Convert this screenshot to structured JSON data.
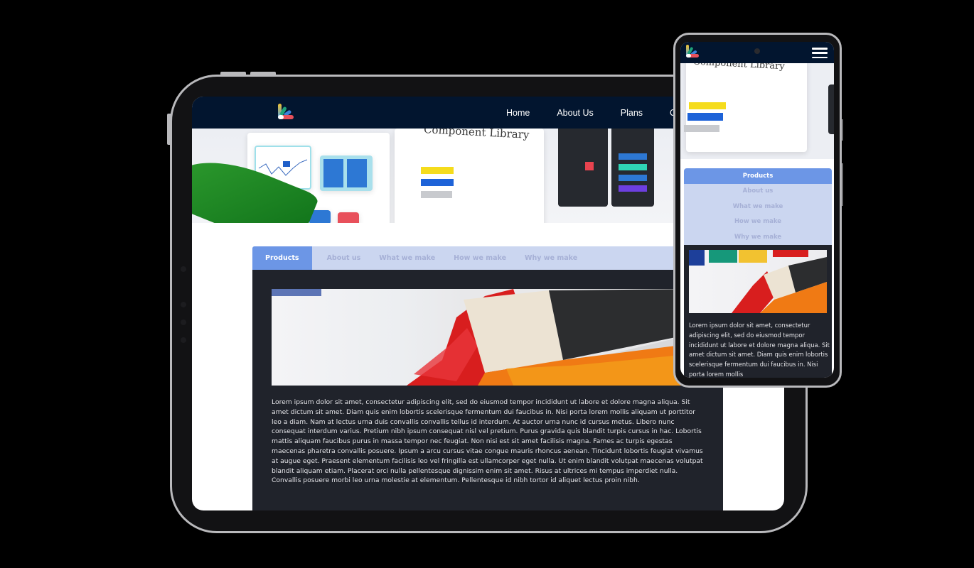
{
  "tablet": {
    "header": {
      "logo": "brand-logo-icon",
      "nav": [
        "Home",
        "About Us",
        "Plans",
        "C"
      ]
    },
    "hero": {
      "title": "Component Library",
      "caption": "Hero image showing UI component library mockups"
    },
    "tabs": [
      {
        "label": "Products",
        "active": true
      },
      {
        "label": "About us",
        "active": false
      },
      {
        "label": "What we make",
        "active": false
      },
      {
        "label": "How we make",
        "active": false
      },
      {
        "label": "Why we make",
        "active": false
      }
    ],
    "panel": {
      "image": "paintbrush-with-red-and-orange-paint",
      "text": "Lorem ipsum dolor sit amet, consectetur adipiscing elit, sed do eiusmod tempor incididunt ut labore et dolore magna aliqua. Sit amet dictum sit amet. Diam quis enim lobortis scelerisque fermentum dui faucibus in. Nisi porta lorem mollis aliquam ut porttitor leo a diam. Nam at lectus urna duis convallis convallis tellus id interdum. At auctor urna nunc id cursus metus. Libero nunc consequat interdum varius. Pretium nibh ipsum consequat nisl vel pretium. Purus gravida quis blandit turpis cursus in hac. Lobortis mattis aliquam faucibus purus in massa tempor nec feugiat. Non nisi est sit amet facilisis magna. Fames ac turpis egestas maecenas pharetra convallis posuere. Ipsum a arcu cursus vitae congue mauris rhoncus aenean. Tincidunt lobortis feugiat vivamus at augue eget. Praesent elementum facilisis leo vel fringilla est ullamcorper eget nulla. Ut enim blandit volutpat maecenas volutpat blandit aliquam etiam. Placerat orci nulla pellentesque dignissim enim sit amet. Risus at ultrices mi tempus imperdiet nulla. Convallis posuere morbi leo urna molestie at elementum. Pellentesque id nibh tortor id aliquet lectus proin nibh."
    }
  },
  "phone": {
    "header": {
      "logo": "brand-logo-icon",
      "menu_icon": "hamburger-menu-icon"
    },
    "hero": {
      "title": "Component Library"
    },
    "tabs": [
      {
        "label": "Products",
        "active": true
      },
      {
        "label": "About us",
        "active": false
      },
      {
        "label": "What we make",
        "active": false
      },
      {
        "label": "How we make",
        "active": false
      },
      {
        "label": "Why we make",
        "active": false
      }
    ],
    "panel": {
      "image": "paintbrush-with-paint-tubes",
      "text": "Lorem ipsum dolor sit amet, consectetur adipiscing elit, sed do eiusmod tempor incididunt ut labore et dolore magna aliqua. Sit amet dictum sit amet. Diam quis enim lobortis scelerisque fermentum dui faucibus in. Nisi porta lorem mollis"
    }
  },
  "colors": {
    "header_bg": "#02152f",
    "tab_active": "#6c96e6",
    "tab_bar": "#cbd6f0",
    "tab_inactive_text": "#a6b0d6",
    "panel_bg": "#20232b",
    "device_frame": "#b9b9bc"
  }
}
